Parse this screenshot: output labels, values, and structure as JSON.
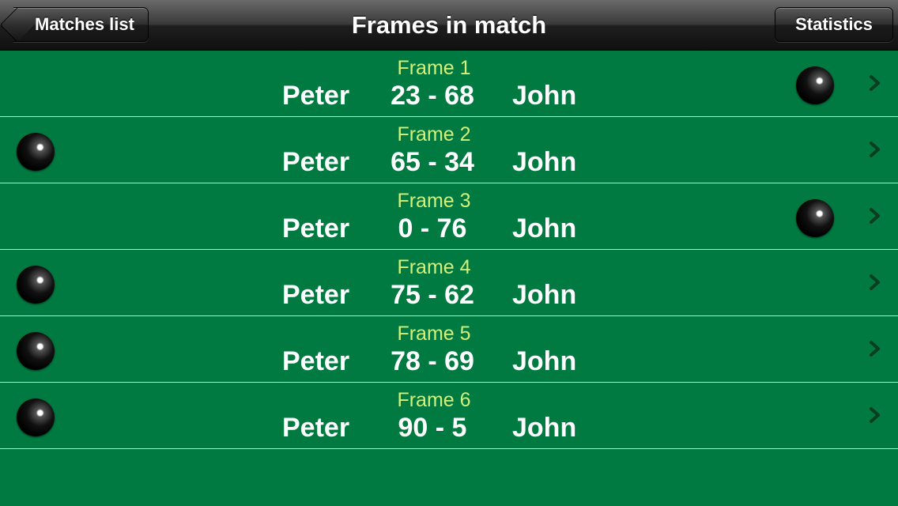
{
  "navbar": {
    "title": "Frames in match",
    "back_label": "Matches list",
    "stats_label": "Statistics"
  },
  "frames": [
    {
      "label": "Frame 1",
      "player_left": "Peter",
      "score": "23 - 68",
      "player_right": "John",
      "winner": "right"
    },
    {
      "label": "Frame 2",
      "player_left": "Peter",
      "score": "65 - 34",
      "player_right": "John",
      "winner": "left"
    },
    {
      "label": "Frame 3",
      "player_left": "Peter",
      "score": "0 - 76",
      "player_right": "John",
      "winner": "right"
    },
    {
      "label": "Frame 4",
      "player_left": "Peter",
      "score": "75 - 62",
      "player_right": "John",
      "winner": "left"
    },
    {
      "label": "Frame 5",
      "player_left": "Peter",
      "score": "78 - 69",
      "player_right": "John",
      "winner": "left"
    },
    {
      "label": "Frame 6",
      "player_left": "Peter",
      "score": "90 - 5",
      "player_right": "John",
      "winner": "left"
    }
  ],
  "colors": {
    "table_green": "#007a40",
    "frame_label": "#d4f07a",
    "divider": "#c8e6c8"
  },
  "icons": {
    "winner_marker": "black-ball-icon",
    "disclosure": "chevron-right-icon"
  }
}
